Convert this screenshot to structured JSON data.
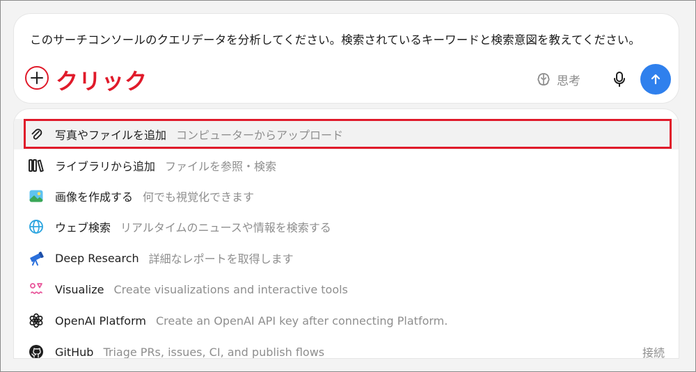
{
  "prompt": {
    "text": "このサーチコンソールのクエリデータを分析してください。検索されているキーワードと検索意図を教えてください。",
    "annotation_label": "クリック",
    "think_label": "思考"
  },
  "menu": {
    "items": [
      {
        "icon": "paperclip-icon",
        "label": "写真やファイルを追加",
        "desc": "コンピューターからアップロード"
      },
      {
        "icon": "library-icon",
        "label": "ライブラリから追加",
        "desc": "ファイルを参照・検索"
      },
      {
        "icon": "image-icon",
        "label": "画像を作成する",
        "desc": "何でも視覚化できます"
      },
      {
        "icon": "globe-icon",
        "label": "ウェブ検索",
        "desc": "リアルタイムのニュースや情報を検索する"
      },
      {
        "icon": "telescope-icon",
        "label": "Deep Research",
        "desc": "詳細なレポートを取得します"
      },
      {
        "icon": "visualize-icon",
        "label": "Visualize",
        "desc": "Create visualizations and interactive tools"
      },
      {
        "icon": "openai-icon",
        "label": "OpenAI Platform",
        "desc": "Create an OpenAI API key after connecting Platform."
      },
      {
        "icon": "github-icon",
        "label": "GitHub",
        "desc": "Triage PRs, issues, CI, and publish flows",
        "action": "接続"
      }
    ]
  },
  "colors": {
    "accent_red": "#e01a2a",
    "send_blue": "#2f80ed"
  }
}
